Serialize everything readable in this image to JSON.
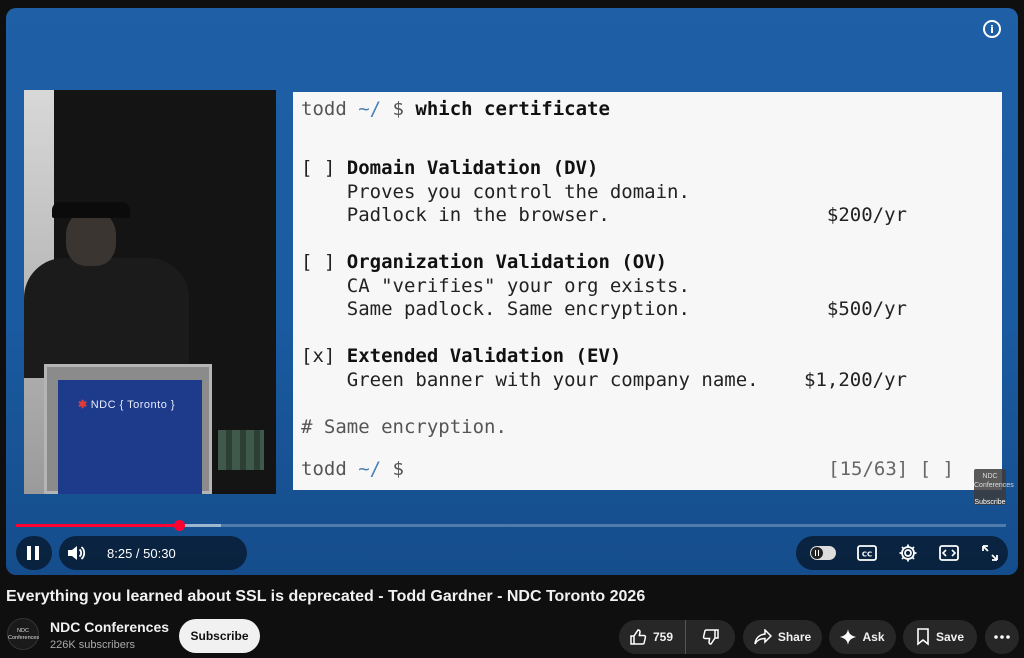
{
  "player": {
    "info_icon": "info-icon",
    "podium_logo_text": "NDC { Toronto }",
    "slide": {
      "line1_prompt": "todd ~/ $ ",
      "line1_cmd": "which certificate",
      "options": [
        {
          "box": "[ ]",
          "title": "Domain Validation (DV)",
          "desc1": "Proves you control the domain.",
          "desc2": "Padlock in the browser.",
          "price": "$200/yr"
        },
        {
          "box": "[ ]",
          "title": "Organization Validation (OV)",
          "desc1": "CA \"verifies\" your org exists.",
          "desc2": "Same padlock. Same encryption.",
          "price": "$500/yr"
        },
        {
          "box": "[x]",
          "title": "Extended Validation (EV)",
          "desc1": "Green banner with your company name.",
          "desc2": "",
          "price": "$1,200/yr"
        }
      ],
      "comment": "# Same encryption.",
      "last_prompt": "todd ~/ $",
      "counter": "[15/63] [ ]"
    },
    "watermark": {
      "text": "NDC Conferences",
      "label": "Subscribe"
    },
    "progress": {
      "played_fraction": 0.165,
      "buffered_fraction": 0.207
    },
    "time": "8:25 / 50:30",
    "controls": {
      "left": [
        "pause-icon",
        "volume-icon"
      ],
      "right": [
        "autoplay-toggle",
        "captions-icon",
        "settings-gear-icon",
        "miniplayer-icon",
        "fullscreen-icon"
      ]
    }
  },
  "video": {
    "title": "Everything you learned about SSL is deprecated - Todd Gardner - NDC Toronto 2026"
  },
  "channel": {
    "avatar_text": "NDC Conferences",
    "name": "NDC Conferences",
    "subscribers": "226K subscribers",
    "subscribe_label": "Subscribe"
  },
  "actions": {
    "like_count": "759",
    "share_label": "Share",
    "ask_label": "Ask",
    "save_label": "Save"
  }
}
